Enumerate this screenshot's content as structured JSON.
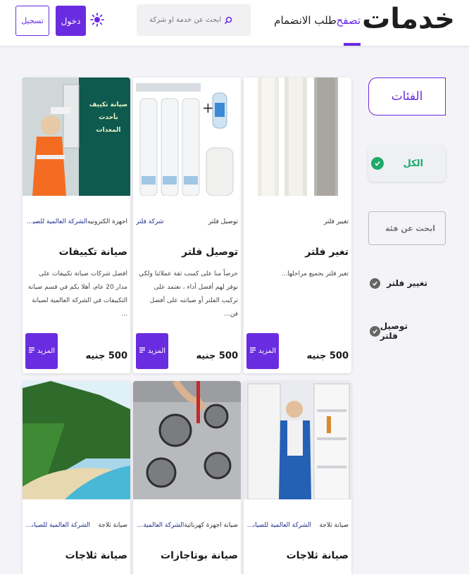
{
  "header": {
    "logo": "خدمات",
    "nav_browse": "تصفح",
    "nav_join": "طلب الانضمام",
    "search_placeholder": "ابحث عن خدمة او شركة",
    "login_label": "دخول",
    "register_label": "تسجيل"
  },
  "sidebar": {
    "title": "الفئات",
    "all_label": "الكل",
    "search_placeholder": "ابحث عن فئة",
    "items": [
      {
        "label": "تغيير فلتر"
      },
      {
        "label": "توصيل فلتر"
      }
    ]
  },
  "cards": [
    {
      "category": "تغيير فلتر",
      "company": "",
      "title": "تغير فلتر",
      "desc": "تغير فلتر بجميع مراحلها...",
      "price": "500 جنيه",
      "more_label": "المزيد"
    },
    {
      "category": "توصيل فلتر",
      "company": "شركة فلتر",
      "title": "توصيل فلتر",
      "desc": "حرصاً منا على كسب ثقة عملائنا ولكي نوفر لهم أفضل أداء ، نعتمد على تركيب الفلتر أو صيانته على أفضل فن...",
      "price": "500 جنيه",
      "more_label": "المزيد"
    },
    {
      "category": "اجهزة الكترونيه",
      "company": "الشركة العالمية للصيانة 2...",
      "title": "صيانة تكييفات",
      "desc": "افضل شركات صيانة تكييفات على مدار 20 عام، أهلا بكم في قسم صيانة التكييفات في الشركة العالمية لصيانة ...",
      "price": "500 جنيه",
      "more_label": "المزيد"
    },
    {
      "category": "صيانة ثلاجة",
      "company": "الشركة العالمية للصيانة 2...",
      "title": "صيانة ثلاجات"
    },
    {
      "category": "صيانة اجهزة كهربائية",
      "company": "الشركة العالمية للصيانة 2...",
      "title": "صيانة بوتاجازات"
    },
    {
      "category": "صيانة ثلاجة",
      "company": "الشركة العالمية للصيانة 2...",
      "title": "صيانة ثلاجات"
    }
  ],
  "promo_image_text": {
    "line1": "صيانة تكييف",
    "line2": "بأحدث",
    "line3": "المعدات"
  },
  "colors": {
    "accent": "#6a2ce0",
    "success": "#1faa6a",
    "link": "#1f2f8a"
  }
}
